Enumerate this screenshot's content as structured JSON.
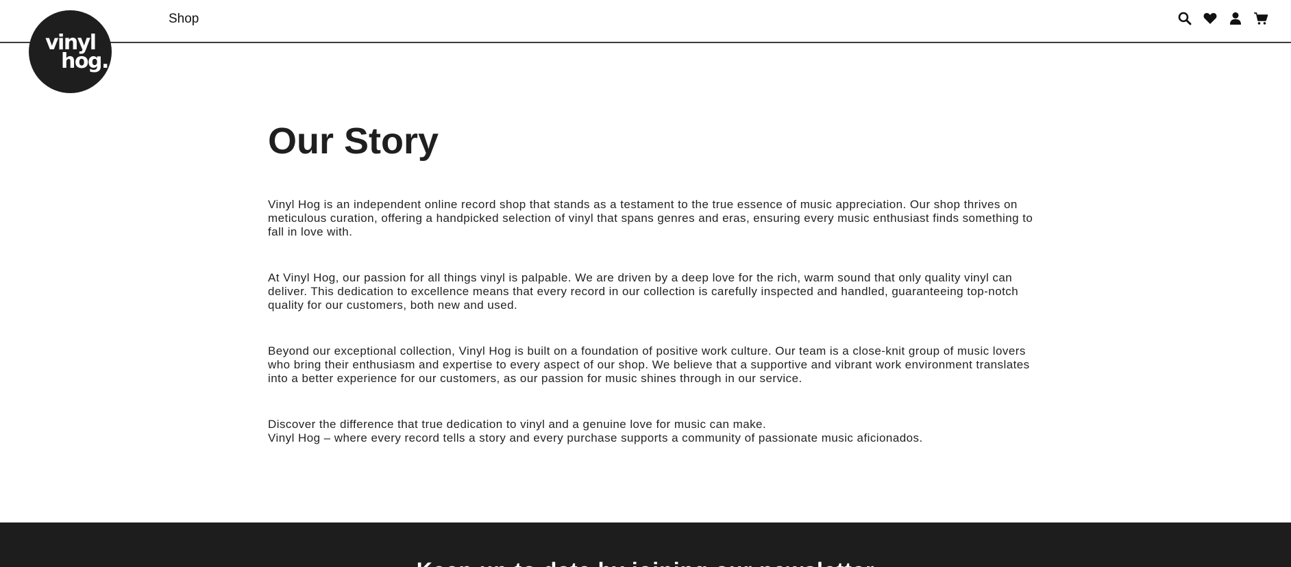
{
  "brand": {
    "logo_line1": "vinyl",
    "logo_line2": "hog."
  },
  "nav": {
    "shop_label": "Shop"
  },
  "header_icons": [
    "search-icon",
    "heart-icon",
    "user-icon",
    "cart-icon"
  ],
  "main": {
    "title": "Our Story",
    "paragraphs": [
      "Vinyl Hog is an independent online record shop that stands as a testament to the true essence of music appreciation. Our shop thrives on meticulous curation, offering a handpicked selection of vinyl that spans genres and eras, ensuring every music enthusiast finds something to fall in love with.",
      "At Vinyl Hog, our passion for all things vinyl is palpable. We are driven by a deep love for the rich, warm sound that only quality vinyl can deliver. This dedication to excellence means that every record in our collection is carefully inspected and handled, guaranteeing top-notch quality for our customers, both new and used.",
      "Beyond our exceptional collection, Vinyl Hog is built on a foundation of positive work culture. Our team is a close-knit group of music lovers who bring their enthusiasm and expertise to every aspect of our shop. We believe that a supportive and vibrant work environment translates into a better experience for our customers, as our passion for music shines through in our service.",
      "Discover the difference that true dedication to vinyl and a genuine love for music can make.\nVinyl Hog – where every record tells a story and every purchase supports a community of passionate music aficionados."
    ]
  },
  "footer": {
    "heading": "Keep up to date by joining our newsletter"
  },
  "colors": {
    "footer_bg": "#1d1d1d",
    "logo_bg": "#1e1e1e",
    "text": "#222222"
  }
}
